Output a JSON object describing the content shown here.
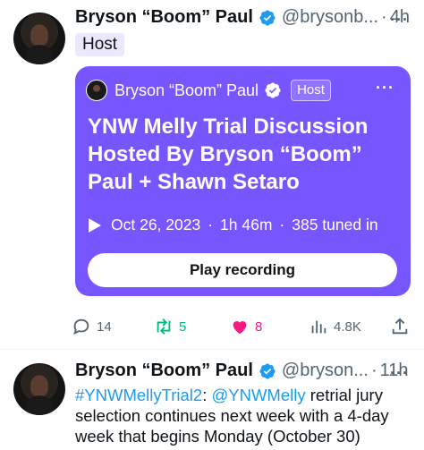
{
  "tweet1": {
    "display_name": "Bryson “Boom” Paul",
    "handle": "@brysonb...",
    "separator": "·",
    "time": "4h",
    "host_label": "Host",
    "space": {
      "host_name": "Bryson “Boom” Paul",
      "host_badge": "Host",
      "title": "YNW Melly Trial Discussion Hosted By Bryson “Boom” Paul + Shawn Setaro",
      "date": "Oct 26, 2023",
      "sep1": "·",
      "duration": "1h 46m",
      "sep2": "·",
      "listeners": "385 tuned in",
      "play_label": "Play recording",
      "card_color": "#7856ff"
    },
    "actions": {
      "replies": "14",
      "reposts": "5",
      "likes": "8",
      "views": "4.8K"
    }
  },
  "tweet2": {
    "display_name": "Bryson “Boom” Paul",
    "handle": "@bryson...",
    "separator": "·",
    "time": "11h",
    "hashtag": "#YNWMellyTrial2",
    "colon": ": ",
    "mention": "@YNWMelly",
    "text_line1_rest": " retrial jury",
    "text_line2": "selection continues next week with a 4-day",
    "text_line3": "week that begins Monday (October 30)"
  },
  "colors": {
    "verified": "#1d9bf0",
    "like": "#f91880",
    "repost": "#00ba7c",
    "link": "#1d9bf0"
  }
}
